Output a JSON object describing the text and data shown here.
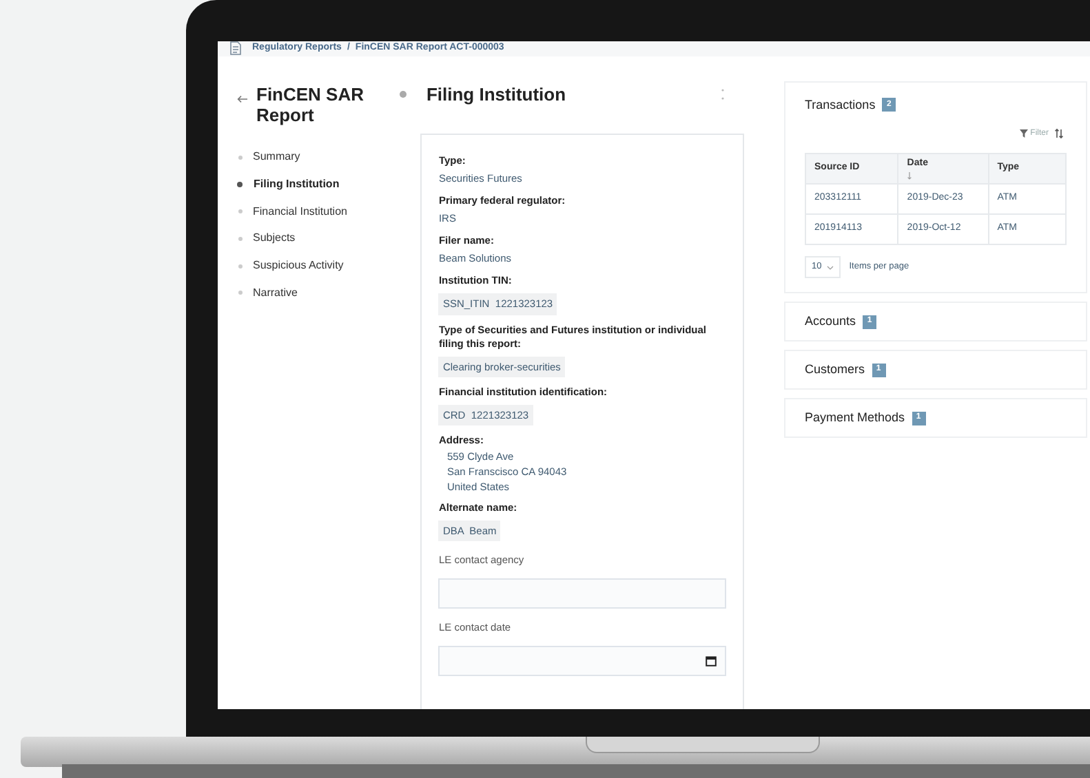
{
  "breadcrumb": {
    "items": [
      "Regulatory Reports",
      "FinCEN SAR Report ACT-000003"
    ],
    "separator": "/"
  },
  "sidebar": {
    "title": "FinCEN SAR Report",
    "items": [
      {
        "label": "Summary",
        "selected": false
      },
      {
        "label": "Filing Institution",
        "selected": true
      },
      {
        "label": "Financial Institution",
        "selected": false
      },
      {
        "label": "Subjects",
        "selected": false
      },
      {
        "label": "Suspicious Activity",
        "selected": false
      },
      {
        "label": "Narrative",
        "selected": false
      }
    ]
  },
  "section": {
    "title": "Filing Institution",
    "fields": [
      {
        "kind": "text",
        "label": "Type:",
        "value": "Securities Futures"
      },
      {
        "kind": "text",
        "label": "Primary federal regulator:",
        "value": "IRS"
      },
      {
        "kind": "text",
        "label": "Filer name:",
        "value": "Beam Solutions"
      },
      {
        "kind": "chip",
        "label": "Institution TIN:",
        "parts": [
          "SSN_ITIN",
          "1221323123"
        ]
      },
      {
        "kind": "chip",
        "label": "Type of Securities and Futures institution or individual filing this report:",
        "parts": [
          "Clearing broker-securities"
        ]
      },
      {
        "kind": "chip",
        "label": "Financial institution identification:",
        "parts": [
          "CRD",
          "1221323123"
        ]
      },
      {
        "kind": "lines",
        "label": "Address:",
        "lines": [
          "559 Clyde Ave",
          "San Franscisco CA 94043",
          "United States"
        ]
      },
      {
        "kind": "chip",
        "label": "Alternate name:",
        "parts": [
          "DBA",
          "Beam"
        ]
      },
      {
        "kind": "input",
        "label": "LE contact agency"
      },
      {
        "kind": "date",
        "label": "LE contact date"
      }
    ]
  },
  "transactions": {
    "title": "Transactions",
    "count": "2",
    "filter": "Filter",
    "columns": [
      {
        "label": "Source ID",
        "sorted": false
      },
      {
        "label": "Date",
        "sorted": true
      },
      {
        "label": "Type",
        "sorted": false
      }
    ],
    "rows": [
      [
        "203312111",
        "2019-Dec-23",
        "ATM"
      ],
      [
        "201914113",
        "2019-Oct-12",
        "ATM"
      ]
    ],
    "page_size": "10",
    "page_size_label": "Items per page"
  },
  "panels": [
    {
      "title": "Accounts",
      "count": "1"
    },
    {
      "title": "Customers",
      "count": "1"
    },
    {
      "title": "Payment Methods",
      "count": "1"
    }
  ]
}
